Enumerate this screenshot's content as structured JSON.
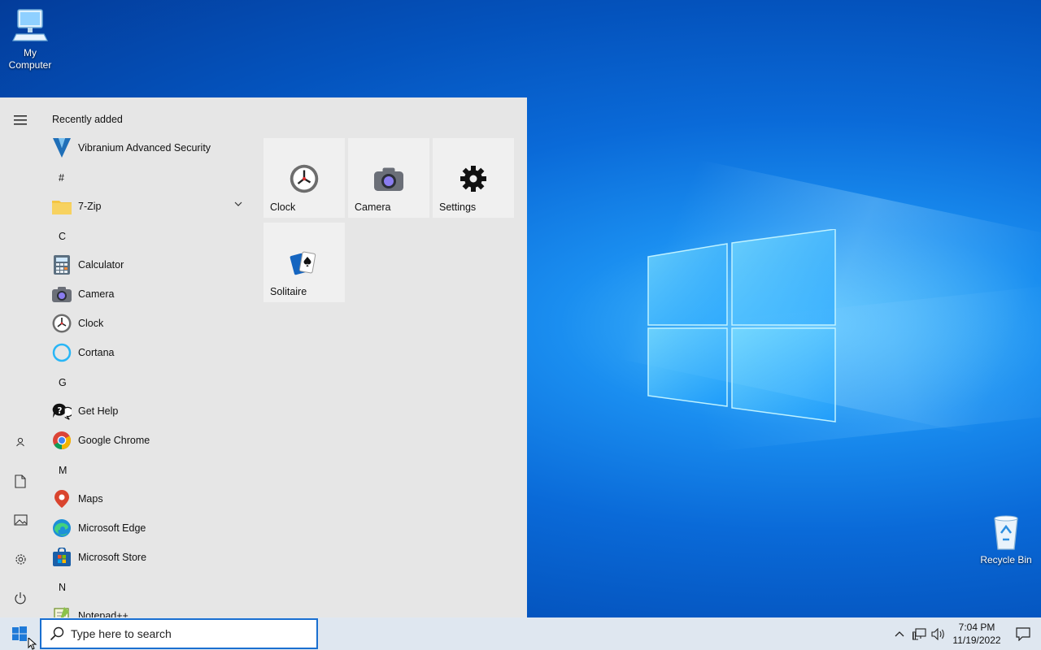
{
  "desktop": {
    "icons": [
      {
        "label": "My\nComputer",
        "icon": "computer-icon"
      },
      {
        "label": "Recycle Bin",
        "icon": "recycle-bin-icon"
      }
    ]
  },
  "start_menu": {
    "rail": {
      "menu_icon": "hamburger-icon",
      "items": [
        "user-icon",
        "document-icon",
        "pictures-icon",
        "settings-icon",
        "power-icon"
      ]
    },
    "recently_added_label": "Recently added",
    "recent_apps": [
      {
        "label": "Vibranium Advanced Security",
        "icon": "vibranium-icon"
      }
    ],
    "groups": [
      {
        "letter": "#",
        "apps": [
          {
            "label": "7-Zip",
            "icon": "folder-icon",
            "expandable": true
          }
        ]
      },
      {
        "letter": "C",
        "apps": [
          {
            "label": "Calculator",
            "icon": "calculator-icon"
          },
          {
            "label": "Camera",
            "icon": "camera-icon"
          },
          {
            "label": "Clock",
            "icon": "clock-icon"
          },
          {
            "label": "Cortana",
            "icon": "cortana-icon"
          }
        ]
      },
      {
        "letter": "G",
        "apps": [
          {
            "label": "Get Help",
            "icon": "help-icon"
          },
          {
            "label": "Google Chrome",
            "icon": "chrome-icon"
          }
        ]
      },
      {
        "letter": "M",
        "apps": [
          {
            "label": "Maps",
            "icon": "maps-icon"
          },
          {
            "label": "Microsoft Edge",
            "icon": "edge-icon"
          },
          {
            "label": "Microsoft Store",
            "icon": "store-icon"
          }
        ]
      },
      {
        "letter": "N",
        "apps": [
          {
            "label": "Notepad++",
            "icon": "notepad-icon"
          }
        ]
      }
    ],
    "tiles": [
      {
        "label": "Clock",
        "icon": "clock-icon"
      },
      {
        "label": "Camera",
        "icon": "camera-icon"
      },
      {
        "label": "Settings",
        "icon": "gear-icon"
      },
      {
        "label": "Solitaire",
        "icon": "solitaire-icon"
      }
    ]
  },
  "taskbar": {
    "start_icon": "windows-logo-icon",
    "search_placeholder": "Type here to search",
    "tray_icons": [
      "chevron-up-icon",
      "network-icon",
      "volume-icon"
    ],
    "time": "7:04 PM",
    "date": "11/19/2022",
    "notification_icon": "action-center-icon"
  },
  "colors": {
    "accent": "#1a6fd0",
    "start_menu_bg": "#e6e6e6",
    "taskbar_bg": "#dfe7f0"
  }
}
